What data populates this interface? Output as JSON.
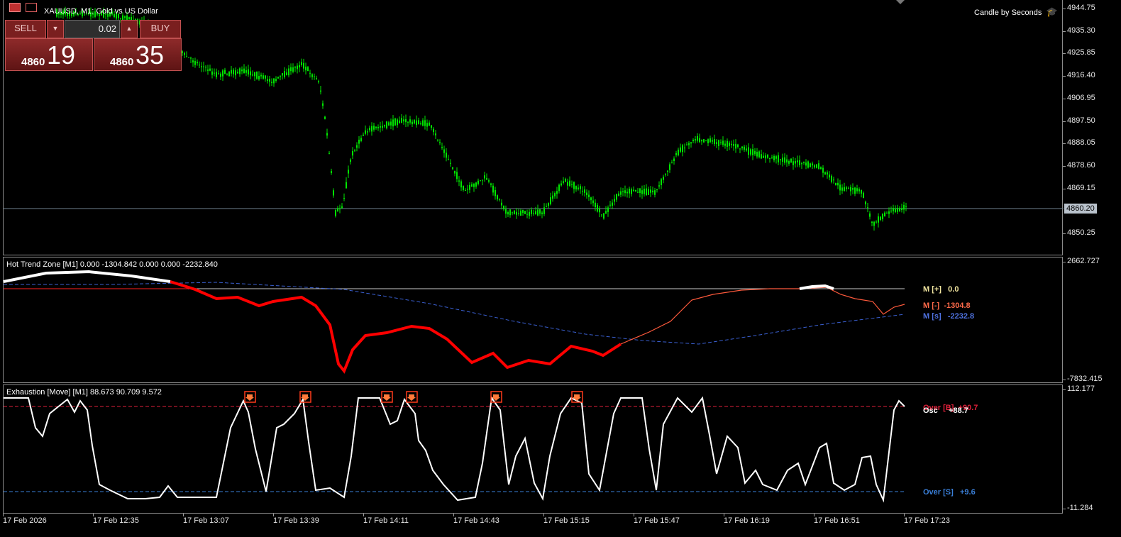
{
  "header": {
    "symbol_title": "XAUUSD, M1:  Gold vs US Dollar",
    "indicator_badge": "Candle by Seconds"
  },
  "trade_panel": {
    "sell_label": "SELL",
    "buy_label": "BUY",
    "volume": "0.02",
    "bid_big": "4860",
    "bid_small": "19",
    "ask_big": "4860",
    "ask_small": "35"
  },
  "price_axis": {
    "ticks": [
      "4944.75",
      "4935.30",
      "4925.85",
      "4916.40",
      "4906.95",
      "4897.50",
      "4888.05",
      "4878.60",
      "4869.15",
      "4850.25"
    ],
    "current_price": "4860.20"
  },
  "htz": {
    "title": "Hot Trend Zone [M1] 0.000 -1304.842 0.000 0.000 -2232.840",
    "axis_top": "2662.727",
    "axis_bottom": "-7832.415",
    "legend_plus_label": "M [+]",
    "legend_plus_value": "0.0",
    "legend_minus_label": "M [-]",
    "legend_minus_value": "-1304.8",
    "legend_s_label": "M [s]",
    "legend_s_value": "-2232.8"
  },
  "exh": {
    "title": "Exhaustion [Move] [M1] 88.673 90.709 9.572",
    "axis_top": "112.177",
    "axis_bottom": "-11.284",
    "over_b_label": "Over [B]",
    "over_b_value": "+90.7",
    "osc_label": "Osc",
    "osc_value": "+88.7",
    "over_s_label": "Over [S]",
    "over_s_value": "+9.6"
  },
  "time_axis": [
    "17 Feb 2026",
    "17 Feb 12:35",
    "17 Feb 13:07",
    "17 Feb 13:39",
    "17 Feb 14:11",
    "17 Feb 14:43",
    "17 Feb 15:15",
    "17 Feb 15:47",
    "17 Feb 16:19",
    "17 Feb 16:51",
    "17 Feb 17:23"
  ],
  "colors": {
    "bull": "#00e600",
    "htz_red": "#ff0000",
    "htz_orange": "#ff5a3c",
    "htz_blue": "#3a5fd0",
    "over_b": "#e0203a",
    "over_s": "#3a7fd8"
  }
}
